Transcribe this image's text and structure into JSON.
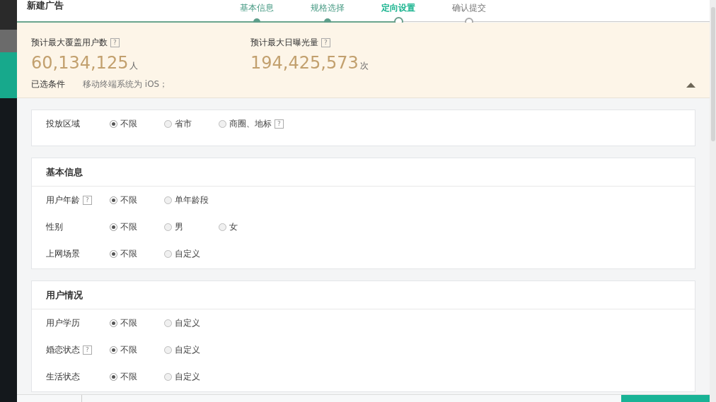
{
  "window": {
    "title": "新建广告"
  },
  "steps": [
    {
      "label": "基本信息",
      "done": true,
      "selected": false
    },
    {
      "label": "规格选择",
      "done": true,
      "selected": false
    },
    {
      "label": "定向设置",
      "done": false,
      "selected": true
    },
    {
      "label": "确认提交",
      "done": false,
      "selected": false
    }
  ],
  "summary": {
    "metrics": [
      {
        "label": "预计最大覆盖用户数",
        "help": "?",
        "value": "60,134,125",
        "unit": "人"
      },
      {
        "label": "预计最大日曝光量",
        "help": "?",
        "value": "194,425,573",
        "unit": "次"
      }
    ],
    "conditions_label": "已选条件",
    "conditions": "移动终端系统为 iOS；",
    "expanded": true
  },
  "sections": [
    {
      "rows": [
        {
          "label": "投放区域",
          "options": [
            {
              "label": "不限",
              "selected": true
            },
            {
              "label": "省市",
              "selected": false
            },
            {
              "label": "商圈、地标",
              "selected": false,
              "help": "?"
            }
          ]
        }
      ]
    },
    {
      "title": "基本信息",
      "rows": [
        {
          "label": "用户年龄",
          "help": "?",
          "options": [
            {
              "label": "不限",
              "selected": true
            },
            {
              "label": "单年龄段",
              "selected": false
            }
          ]
        },
        {
          "label": "性别",
          "options": [
            {
              "label": "不限",
              "selected": true
            },
            {
              "label": "男",
              "selected": false
            },
            {
              "label": "女",
              "selected": false
            }
          ]
        },
        {
          "label": "上网场景",
          "options": [
            {
              "label": "不限",
              "selected": true
            },
            {
              "label": "自定义",
              "selected": false
            }
          ]
        }
      ]
    },
    {
      "title": "用户情况",
      "rows": [
        {
          "label": "用户学历",
          "options": [
            {
              "label": "不限",
              "selected": true
            },
            {
              "label": "自定义",
              "selected": false
            }
          ]
        },
        {
          "label": "婚恋状态",
          "help": "?",
          "options": [
            {
              "label": "不限",
              "selected": true
            },
            {
              "label": "自定义",
              "selected": false
            }
          ]
        },
        {
          "label": "生活状态",
          "options": [
            {
              "label": "不限",
              "selected": true
            },
            {
              "label": "自定义",
              "selected": false
            }
          ]
        }
      ]
    }
  ]
}
